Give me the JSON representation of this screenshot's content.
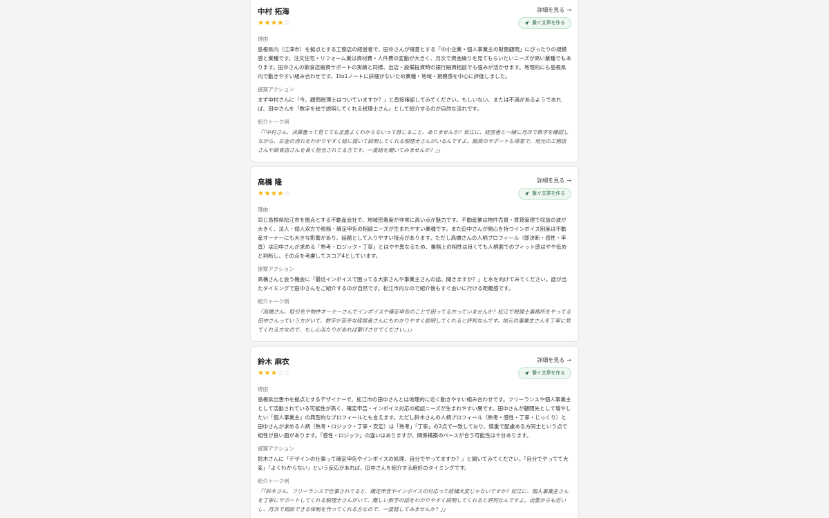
{
  "ui": {
    "detail_label": "詳細を見る",
    "detail_arrow": "→",
    "compose_label": "繋ぐ文章を作る",
    "reason_label": "理由",
    "action_label": "提案アクション",
    "talk_label": "紹介トーク例"
  },
  "colors": {
    "star_filled": "#f5b301",
    "star_empty": "#c8c8c8",
    "pill_bg": "#eef8f1",
    "pill_text": "#2f6a47"
  },
  "cards": [
    {
      "name": "中村 拓海",
      "rating": 4,
      "max_rating": 5,
      "reason": "島根県内（江津市）を拠点とする工務店の経営者で、田中さんが得意とする「中小企業・個人事業主の財務顧問」にぴったりの規模感と業種です。注文住宅・リフォーム業は資材費・人件費の変動が大きく、月次で資金繰りを見てもらいたいニーズが高い業種でもあります。田中さんの飲食店融資サポートの実績と同様、出店・設備投資時の銀行融資相談でも強みが活かせます。地理的にも島根県内で動きやすい組み合わせです。1to1ノートに詳細がないため業種・地域・規模感を中心に評価しました。",
      "action": "まず中村さんに「今、顧問税理士はついていますか？」と直接確認してみてください。もしいない、または不満があるようであれば、田中さんを「数字を絵で説明してくれる税理士さん」として紹介するのが自然な流れです。",
      "talk": "「「中村さん、決算書って見てても正直よくわからないって感じること、ありませんか？松江に、経営者と一緒に月次で数字を確認しながら、お金の流れをわかりやすく絵に描いて説明してくれる税理士さんがいるんですよ。融資のサポートも得意で、地元の工務店さんや飲食店さんを長く担当されてる方です。一度話を聞いてみませんか？」」"
    },
    {
      "name": "高橋 隆",
      "rating": 4,
      "max_rating": 5,
      "reason": "同じ島根県松江市を拠点とする不動産会社で、地域密着度が非常に高い点が魅力です。不動産業は物件売買・賃貸管理で収益の波が大きく、法人・個人双方で税務・確定申告の相談ニーズが生まれやすい業種です。また田中さんが関心を持つインボイス制度は不動産オーナーにも大きな影響があり、話題として入りやすい接点があります。ただし高橋さんの人柄プロフィール（即決断・感性・率直）は田中さんが求める「熟考・ロジック・丁寧」とはやや異なるため、業務上の相性は良くても人柄面でのフィット感はやや低めと判断し、その点を考慮してスコア4としています。",
      "action": "高橋さんと会う機会に「最近インボイスで困ってる大家さんや事業主さんの話、聞きますか？」と水を向けてみてください。話が出たタイミングで田中さんをご紹介するのが自然です。松江市内なので紹介後もすぐ会いに行ける距離感です。",
      "talk": "「高橋さん、取引先や物件オーナーさんでインボイスや確定申告のことで困ってる方っていませんか？松江で税理士事務所をやってる田中さんっていう方がいて、数字が苦手な経営者さんにもわかりやすく説明してくれると評判なんです。地元の事業主さんを丁寧に見てくれる方なので、もし心当たりがあれば繋げさせてください。」」"
    },
    {
      "name": "鈴木 麻衣",
      "rating": 3,
      "max_rating": 5,
      "reason": "島根県出雲市を拠点とするデザイナーで、松江市の田中さんとは地理的に近く動きやすい組み合わせです。フリーランスや個人事業主として活動されている可能性が高く、確定申告・インボイス対応の相談ニーズが生まれやすい層です。田中さんが顧問先として増やしたい「個人事業主」の典型的なプロフィールとも言えます。ただし鈴木さんの人柄プロフィール（熟考・感性・丁寧・じっくり）と田中さんが求める人柄（熟考・ロジック・丁寧・安定）は「熟考」「丁寧」の2点で一致しており、慎重で配慮ある方同士という点で相性が良い面があります。「感性・ロジック」の違いはありますが、関係構築のペースが合う可能性は十分あります。",
      "action": "鈴木さんに「デザインの仕事って確定申告やインボイスの処理、自分でやってますか？」と聞いてみてください。「自分でやってて大変」「よくわからない」という反応があれば、田中さんを紹介する絶好のタイミングです。",
      "talk": "「「鈴木さん、フリーランスで仕事されてると、確定申告やインボイスの対応って結構大変じゃないですか？松江に、個人事業主さんを丁寧にサポートしてくれる税理士さんがいて、難しい数字の話をわかりやすく説明してくれると評判なんですよ。出雲からも近いし、月次で相談できる体制を作ってくれる方なので、一度話してみませんか？」」"
    }
  ]
}
